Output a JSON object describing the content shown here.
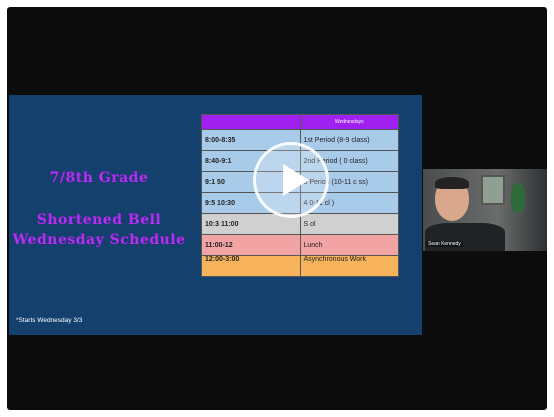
{
  "slide": {
    "title_line1": "7/8th Grade",
    "title_line2": "Shortened Bell Wednesday Schedule",
    "footnote": "*Starts Wednesday 3/3"
  },
  "schedule": {
    "header_time": "",
    "header_day": "Wednesdays",
    "rows": [
      {
        "time": "8:00-8:35",
        "activity": "1st Period (8-9 class)",
        "color": "#a9cbea"
      },
      {
        "time": "8:40-9:1",
        "activity": "2nd Period ( 0 class)",
        "color": "#a9cbea"
      },
      {
        "time": "9:1  50",
        "activity": "3 Period (10-11 c  ss)",
        "color": "#a9cbea"
      },
      {
        "time": "9:5  10:30",
        "activity": "4  0-11 cl  )",
        "color": "#a9cbea"
      },
      {
        "time": "10:3  11:00",
        "activity": "S  ol",
        "color": "#d0d0d0"
      },
      {
        "time": "11:00-12",
        "activity": "Lunch",
        "color": "#f2a3a3"
      },
      {
        "time": "12:00-3:00",
        "activity": "Asynchronous Work",
        "color": "#f7b35b"
      }
    ]
  },
  "webcam": {
    "name_label": "Sean Kennedy"
  },
  "colors": {
    "slide_bg": "#14406e",
    "title_purple": "#b031f0",
    "header_purple": "#a020f0"
  }
}
